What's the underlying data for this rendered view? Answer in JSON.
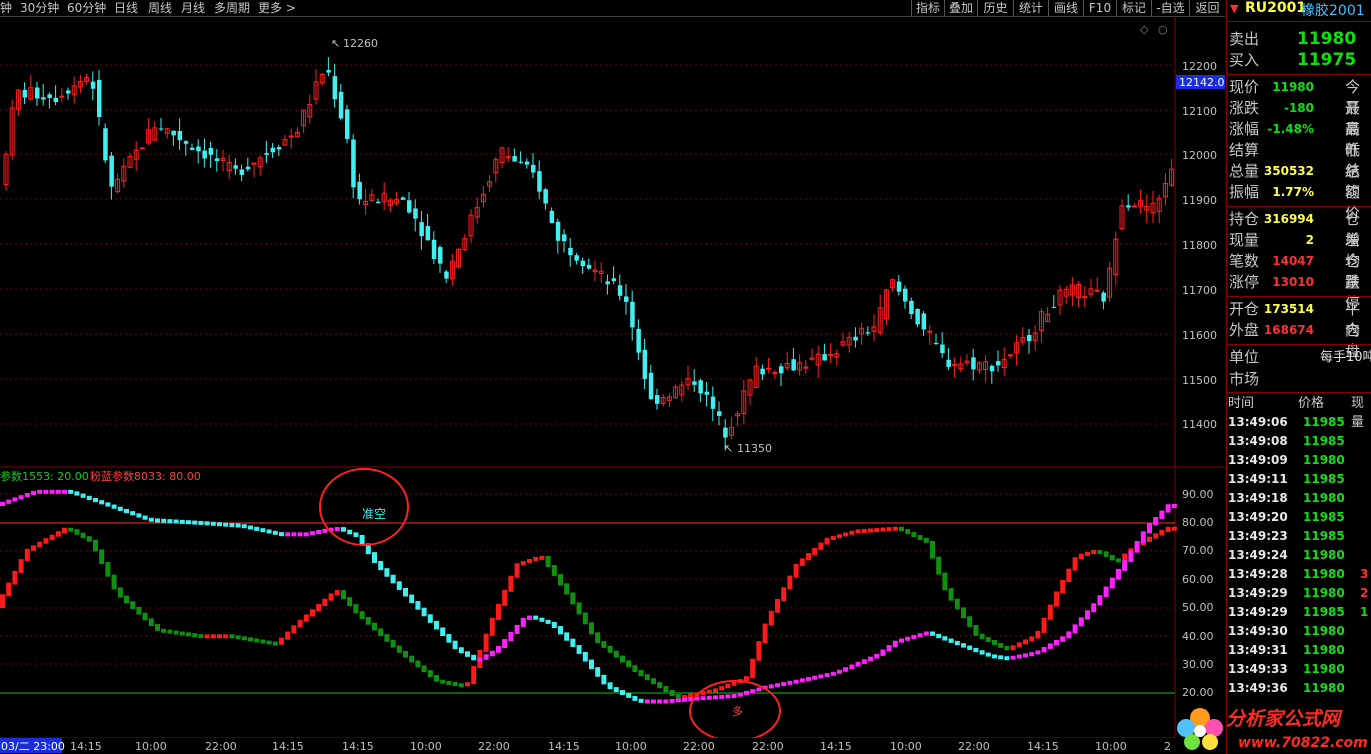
{
  "toolbar": {
    "left_items": [
      "钟",
      "30分钟",
      "60分钟",
      "日线",
      "周线",
      "月线",
      "多周期",
      "更多 >"
    ],
    "right_items": [
      "指标",
      "叠加",
      "历史",
      "统计",
      "画线",
      "F10",
      "标记",
      "-自选",
      "返回"
    ]
  },
  "price_axis": {
    "ticks": [
      "12200",
      "12100",
      "12000",
      "11900",
      "11800",
      "11700",
      "11600",
      "11500",
      "11400"
    ],
    "current_price_tag": "12142.0",
    "high_label": "12260",
    "low_label": "11350"
  },
  "indicator": {
    "legend_1": "参数1553: 20.00",
    "legend_2": "粉蓝参数8033: 80.00",
    "ticks": [
      "90.00",
      "80.00",
      "70.00",
      "60.00",
      "50.00",
      "40.00",
      "30.00",
      "20.00"
    ],
    "annotation_short": "准空",
    "annotation_long": "多"
  },
  "time_axis": {
    "start_label": "03/二 23:00",
    "labels": [
      "14:15",
      "10:00",
      "22:00",
      "14:15",
      "14:15",
      "10:00",
      "22:00",
      "14:15",
      "10:00",
      "22:00",
      "22:00",
      "14:15",
      "10:00",
      "22:00",
      "14:15",
      "10:00",
      "2"
    ]
  },
  "quote": {
    "symbol": "RU2001",
    "name": "橡胶2001",
    "sell_label": "卖出",
    "sell_price": "11980",
    "buy_label": "买入",
    "buy_price": "11975",
    "rows_a": [
      {
        "label": "现价",
        "value": "11980",
        "right": "今开"
      },
      {
        "label": "涨跌",
        "value": "-180",
        "right": "最高"
      },
      {
        "label": "涨幅",
        "value": "-1.48%",
        "right": "最低"
      },
      {
        "label": "结算",
        "value": "",
        "right": "昨结"
      },
      {
        "label": "总量",
        "value": "350532",
        "right": "总额"
      },
      {
        "label": "振幅",
        "value": "1.77%",
        "right": "均价"
      }
    ],
    "rows_b": [
      {
        "label": "持仓",
        "value": "316994",
        "right": "仓差"
      },
      {
        "label": "现量",
        "value": "2",
        "right": "增仓"
      },
      {
        "label": "笔数",
        "value": "14047",
        "right": "均量"
      },
      {
        "label": "涨停",
        "value": "13010",
        "right": "跌停"
      }
    ],
    "rows_c": [
      {
        "label": "开仓",
        "value": "173514",
        "right": "平仓"
      },
      {
        "label": "外盘",
        "value": "168674",
        "right": "内盘"
      }
    ],
    "unit_label": "单位",
    "unit_value": "每手10吨",
    "market_label": "市场"
  },
  "ticks": {
    "headers": [
      "时间",
      "价格",
      "现量"
    ],
    "rows": [
      {
        "time": "13:49:06",
        "price": "11985",
        "vol": ""
      },
      {
        "time": "13:49:08",
        "price": "11985",
        "vol": ""
      },
      {
        "time": "13:49:09",
        "price": "11980",
        "vol": ""
      },
      {
        "time": "13:49:11",
        "price": "11985",
        "vol": ""
      },
      {
        "time": "13:49:18",
        "price": "11980",
        "vol": ""
      },
      {
        "time": "13:49:20",
        "price": "11985",
        "vol": ""
      },
      {
        "time": "13:49:23",
        "price": "11985",
        "vol": ""
      },
      {
        "time": "13:49:24",
        "price": "11980",
        "vol": ""
      },
      {
        "time": "13:49:28",
        "price": "11980",
        "vol": "3"
      },
      {
        "time": "13:49:29",
        "price": "11980",
        "vol": "2"
      },
      {
        "time": "13:49:29",
        "price": "11985",
        "vol": "1"
      },
      {
        "time": "13:49:30",
        "price": "11980",
        "vol": ""
      },
      {
        "time": "13:49:31",
        "price": "11980",
        "vol": ""
      },
      {
        "time": "13:49:33",
        "price": "11980",
        "vol": ""
      },
      {
        "time": "13:49:36",
        "price": "11980",
        "vol": ""
      }
    ]
  },
  "watermark": {
    "line1": "分析家公式网",
    "line2": "www.70822.com"
  },
  "colors": {
    "up": "#ff2020",
    "down": "#40f0f0",
    "green": "#10c010",
    "magenta": "#ff20ff",
    "grid": "#7a0000"
  }
}
